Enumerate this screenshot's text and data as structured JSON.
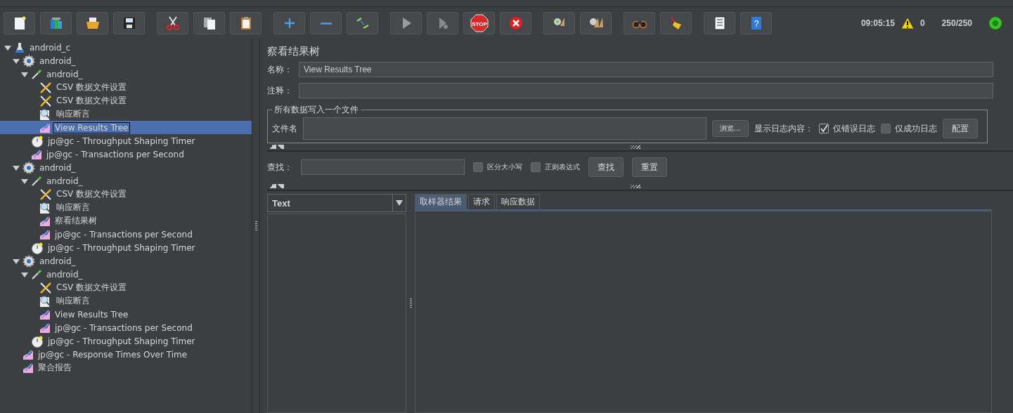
{
  "toolbar": [
    [
      {
        "kind": "new"
      },
      {
        "kind": "templates"
      },
      {
        "kind": "open"
      },
      {
        "kind": "save"
      }
    ],
    [
      {
        "kind": "cut"
      },
      {
        "kind": "copy"
      },
      {
        "kind": "paste"
      }
    ],
    [
      {
        "kind": "expand"
      },
      {
        "kind": "collapse"
      },
      {
        "kind": "toggle"
      }
    ],
    [
      {
        "kind": "start"
      },
      {
        "kind": "start-no-pause"
      },
      {
        "kind": "stop",
        "label": "STOP"
      },
      {
        "kind": "shutdown"
      }
    ],
    [
      {
        "kind": "clear"
      },
      {
        "kind": "clear-all"
      }
    ],
    [
      {
        "kind": "search"
      },
      {
        "kind": "reset-search"
      }
    ],
    [
      {
        "kind": "functions"
      },
      {
        "kind": "help",
        "label": "?"
      }
    ]
  ],
  "status": {
    "time": "09:05:15",
    "warnings": "0",
    "threads": "250/250"
  },
  "tree": [
    {
      "kind": "plan",
      "label": "android_c",
      "selected": false,
      "expanded": true,
      "children": [
        {
          "kind": "thread-group",
          "label": "android_",
          "selected": false,
          "expanded": true,
          "children": [
            {
              "kind": "controller",
              "label": "android_",
              "selected": false,
              "expanded": true,
              "children": [
                {
                  "kind": "config",
                  "label": "CSV 数据文件设置",
                  "selected": false
                },
                {
                  "kind": "config",
                  "label": "CSV 数据文件设置",
                  "selected": false
                },
                {
                  "kind": "assertion",
                  "label": "响应断言",
                  "selected": false
                },
                {
                  "kind": "listener",
                  "label": "View Results Tree",
                  "selected": true
                }
              ]
            },
            {
              "kind": "timer",
              "label": "jp@gc - Throughput Shaping Timer",
              "selected": false
            },
            {
              "kind": "listener",
              "label": "jp@gc - Transactions per Second",
              "selected": false
            }
          ]
        },
        {
          "kind": "thread-group",
          "label": "android_",
          "selected": false,
          "expanded": true,
          "children": [
            {
              "kind": "controller",
              "label": "android_",
              "selected": false,
              "expanded": true,
              "children": [
                {
                  "kind": "config",
                  "label": "CSV 数据文件设置",
                  "selected": false
                },
                {
                  "kind": "assertion",
                  "label": "响应断言",
                  "selected": false
                },
                {
                  "kind": "listener",
                  "label": "察看结果树",
                  "selected": false
                },
                {
                  "kind": "listener",
                  "label": "jp@gc - Transactions per Second",
                  "selected": false
                }
              ]
            },
            {
              "kind": "timer",
              "label": "jp@gc - Throughput Shaping Timer",
              "selected": false
            }
          ]
        },
        {
          "kind": "thread-group",
          "label": "android_",
          "selected": false,
          "expanded": true,
          "children": [
            {
              "kind": "controller",
              "label": "android_",
              "selected": false,
              "expanded": true,
              "children": [
                {
                  "kind": "config",
                  "label": "CSV 数据文件设置",
                  "selected": false
                },
                {
                  "kind": "assertion",
                  "label": "响应断言",
                  "selected": false
                },
                {
                  "kind": "listener",
                  "label": "View Results Tree",
                  "selected": false
                },
                {
                  "kind": "listener",
                  "label": "jp@gc - Transactions per Second",
                  "selected": false
                }
              ]
            },
            {
              "kind": "timer",
              "label": "jp@gc - Throughput Shaping Timer",
              "selected": false
            }
          ]
        },
        {
          "kind": "listener",
          "label": "jp@gc - Response Times Over Time",
          "selected": false
        },
        {
          "kind": "listener",
          "label": "聚合报告",
          "selected": false
        }
      ]
    }
  ],
  "panel": {
    "title": "察看结果树",
    "name_label": "名称：",
    "name_value": "View Results Tree",
    "comment_label": "注释：",
    "file_group": {
      "legend": "所有数据写入一个文件",
      "file_label": "文件名",
      "browse": "浏览...",
      "log_label": "显示日志内容：",
      "options": [
        {
          "label": "仅错误日志",
          "checked": true
        },
        {
          "label": "仅成功日志",
          "checked": false
        }
      ],
      "configure": "配置"
    },
    "search": {
      "label": "查找：",
      "options": [
        {
          "label": "区分大小写",
          "checked": false
        },
        {
          "label": "正则表达式",
          "checked": false
        }
      ],
      "find": "查找",
      "reset": "重置"
    },
    "renderer": "Text",
    "tabs": [
      {
        "label": "取样器结果",
        "selected": true
      },
      {
        "label": "请求",
        "selected": false
      },
      {
        "label": "响应数据",
        "selected": false
      }
    ]
  }
}
